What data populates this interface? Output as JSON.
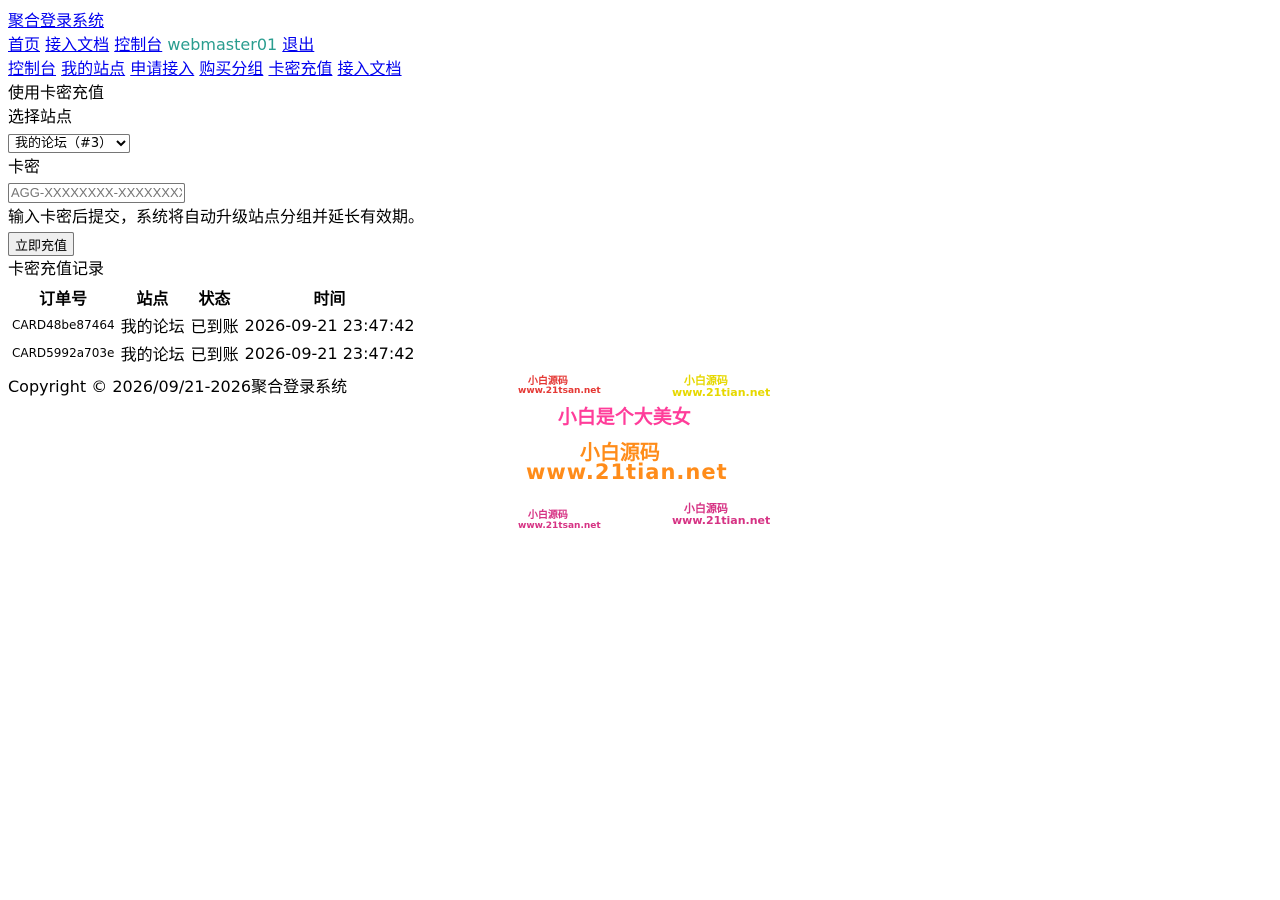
{
  "header": {
    "site_title": "聚合登录系统",
    "nav": {
      "home": "首页",
      "docs": "接入文档",
      "console": "控制台",
      "username": "webmaster01",
      "logout": "退出"
    }
  },
  "subnav": {
    "console": "控制台",
    "my_sites": "我的站点",
    "apply": "申请接入",
    "buy_group": "购买分组",
    "card_recharge": "卡密充值",
    "docs": "接入文档"
  },
  "form": {
    "heading": "使用卡密充值",
    "site_label": "选择站点",
    "site_selected": "我的论坛（#3）",
    "card_label": "卡密",
    "card_placeholder": "AGG-XXXXXXXX-XXXXXXXX",
    "hint": "输入卡密后提交，系统将自动升级站点分组并延长有效期。",
    "submit_label": "立即充值"
  },
  "records": {
    "heading": "卡密充值记录",
    "columns": [
      "订单号",
      "站点",
      "状态",
      "时间"
    ],
    "rows": [
      [
        "CARD48be87464",
        "我的论坛",
        "已到账",
        "2026-09-21 23:47:42"
      ],
      [
        "CARD5992a703e",
        "我的论坛",
        "已到账",
        "2026-09-21 23:47:42"
      ]
    ]
  },
  "footer": {
    "copyright": "Copyright © 2026/09/21-2026聚合登录系统"
  },
  "watermark": {
    "line1_left": "小白源码",
    "line1_left_url": "www.21tsan.net",
    "line1_right": "小白源码",
    "line1_right_url": "www.21tian.net",
    "main": "小白是个大美女",
    "brand": "小白源码",
    "brand_url": "www.21tian.net",
    "bottom_left": "小白源码",
    "bottom_left_url": "www.21tsan.net",
    "bottom_right": "小白源码",
    "bottom_right_url": "www.21tian.net",
    "colors": {
      "red": "#e53935",
      "yellow": "#e6d800",
      "pink": "#ff3d9a",
      "orange": "#ff8c1a",
      "magenta": "#d63384"
    }
  }
}
